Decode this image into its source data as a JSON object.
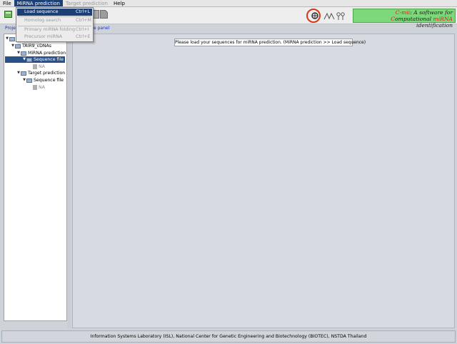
{
  "menubar": {
    "items": [
      {
        "label": "File",
        "state": "normal"
      },
      {
        "label": "MiRNA prediction",
        "state": "active"
      },
      {
        "label": "Target prediction",
        "state": "disabled"
      },
      {
        "label": "Help",
        "state": "normal"
      }
    ]
  },
  "dropdown": {
    "items": [
      {
        "label": "Load sequence",
        "accelerator": "Ctrl+L",
        "state": "selected"
      },
      {
        "label": "Homolog search",
        "accelerator": "Ctrl+M",
        "state": "disabled"
      },
      {
        "label": "Primary miRNA folding",
        "accelerator": "Ctrl+I",
        "state": "disabled"
      },
      {
        "label": "Precursor miRNA folding",
        "accelerator": "Ctrl+E",
        "state": "disabled"
      }
    ]
  },
  "logo": {
    "line1_prefix": "C-mii",
    "line1_rest": ": A software for",
    "line2_c": "C",
    "line2_a": "omputational ",
    "line2_mirna": "miRNA",
    "line2_b": " identification",
    "brand_color": "#7cd87a",
    "accent_color": "#d62020"
  },
  "tabs": {
    "left": "Proje",
    "right": "e panel"
  },
  "tree": {
    "root_label": "TAIR9_cDNAs",
    "mirna_label": "MiRNA prediction",
    "mirna_file_label": "Sequence file",
    "mirna_file_value": "NA",
    "target_label": "Target prediction",
    "target_file_label": "Sequence file",
    "target_file_value": "NA"
  },
  "notice": {
    "text": "Please load your sequences for miRNA prediction. (MiRNA prediction >> Load sequence)"
  },
  "statusbar": {
    "text": "Information Systems Laboratory (ISL), National Center for Genetic Engineering and Biotechnology (BIOTEC), NSTDA Thailand"
  },
  "colors": {
    "menu_active": "#1c3f76",
    "tree_selected": "#2a5187",
    "link": "#1a2fc8"
  }
}
